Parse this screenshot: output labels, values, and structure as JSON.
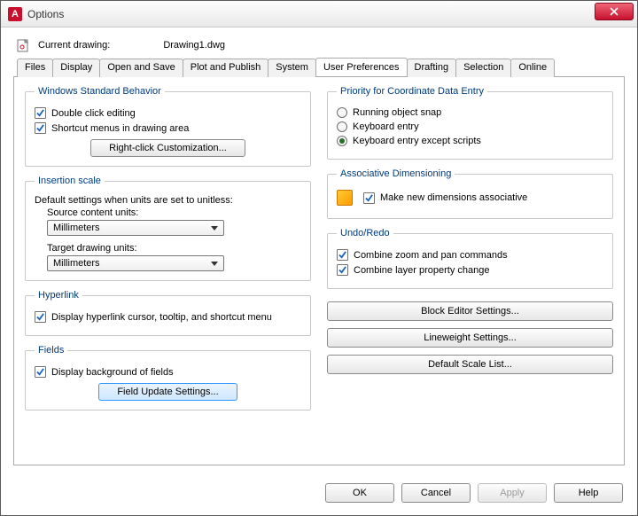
{
  "window": {
    "title": "Options"
  },
  "header": {
    "current_drawing_label": "Current drawing:",
    "current_drawing_value": "Drawing1.dwg"
  },
  "tabs": [
    "Files",
    "Display",
    "Open and Save",
    "Plot and Publish",
    "System",
    "User Preferences",
    "Drafting",
    "Selection",
    "Online"
  ],
  "active_tab": "User Preferences",
  "left": {
    "wsb": {
      "legend": "Windows Standard Behavior",
      "double_click": "Double click editing",
      "shortcut_menus": "Shortcut menus in drawing area",
      "rcc_btn": "Right-click Customization..."
    },
    "insertion": {
      "legend": "Insertion scale",
      "note": "Default settings when units are set to unitless:",
      "source_label": "Source content units:",
      "source_value": "Millimeters",
      "target_label": "Target drawing units:",
      "target_value": "Millimeters"
    },
    "hyperlink": {
      "legend": "Hyperlink",
      "display": "Display hyperlink cursor, tooltip, and shortcut menu"
    },
    "fields": {
      "legend": "Fields",
      "bg": "Display background of fields",
      "btn": "Field Update Settings..."
    }
  },
  "right": {
    "priority": {
      "legend": "Priority for Coordinate Data Entry",
      "r1": "Running object snap",
      "r2": "Keyboard entry",
      "r3": "Keyboard entry except scripts"
    },
    "assoc": {
      "legend": "Associative Dimensioning",
      "c1": "Make new dimensions associative"
    },
    "undo": {
      "legend": "Undo/Redo",
      "c1": "Combine zoom and pan commands",
      "c2": "Combine layer property change"
    },
    "buttons": {
      "b1": "Block Editor Settings...",
      "b2": "Lineweight Settings...",
      "b3": "Default Scale List..."
    }
  },
  "footer": {
    "ok": "OK",
    "cancel": "Cancel",
    "apply": "Apply",
    "help": "Help"
  }
}
